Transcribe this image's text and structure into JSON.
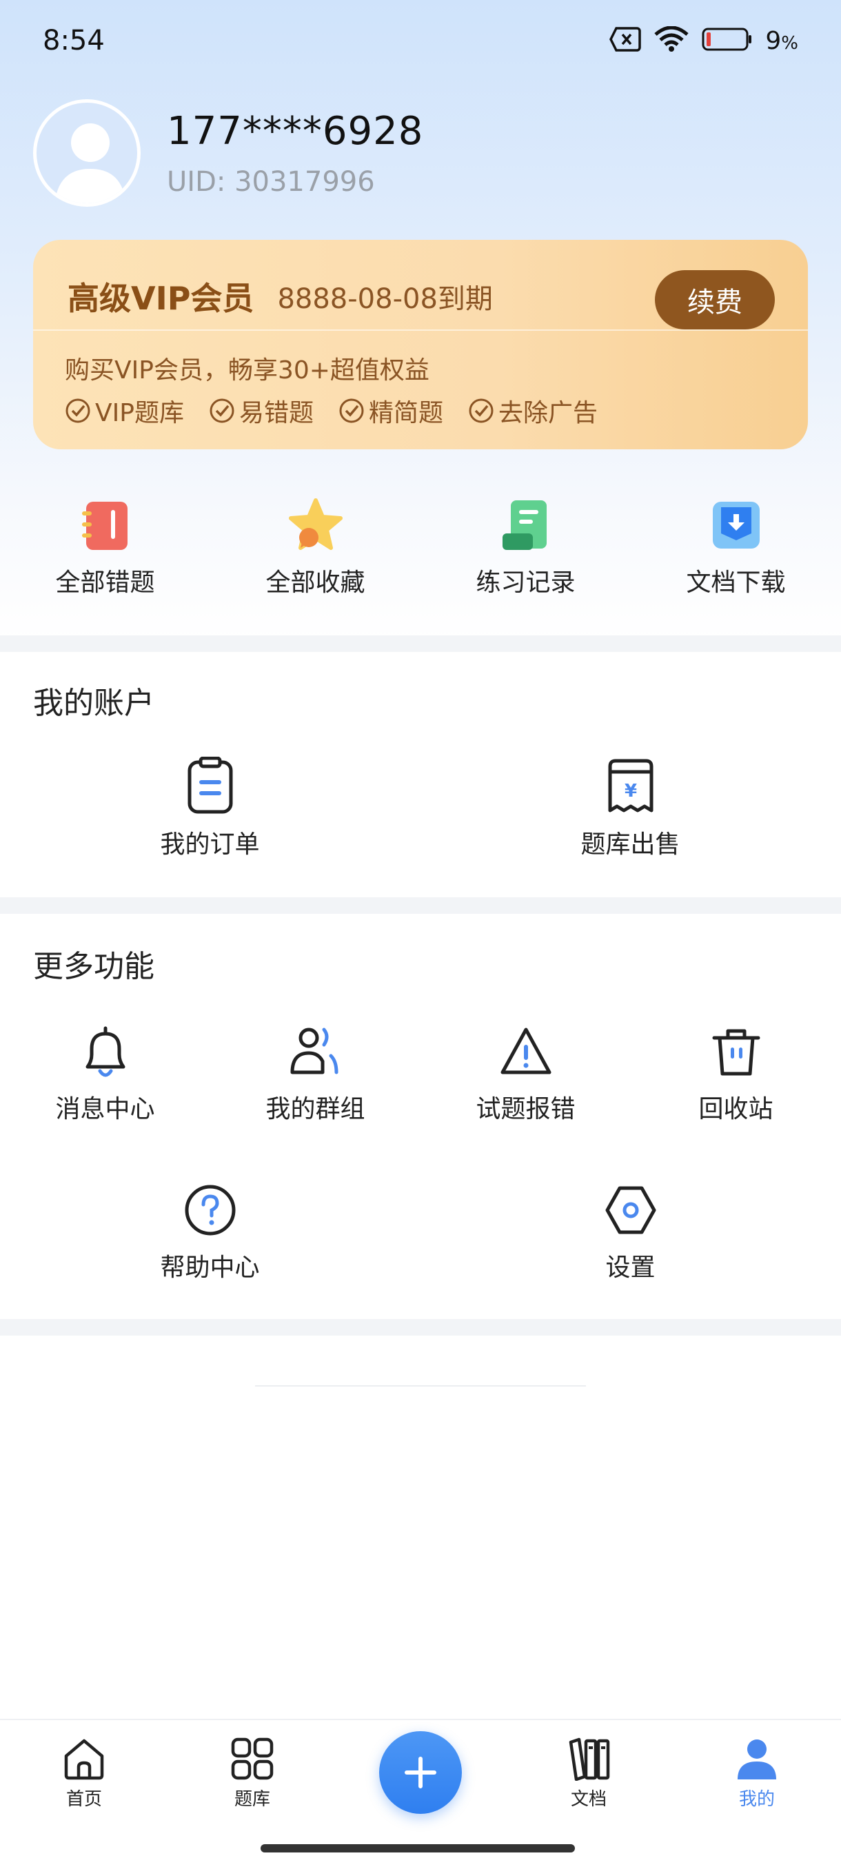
{
  "status_bar": {
    "time": "8:54",
    "battery": "9",
    "battery_unit": "%"
  },
  "profile": {
    "phone": "177****6928",
    "uid": "UID: 30317996"
  },
  "vip": {
    "title": "高级VIP会员",
    "expire": "8888-08-08到期",
    "renew_label": "续费",
    "description": "购买VIP会员，畅享30+超值权益",
    "tags": [
      "VIP题库",
      "易错题",
      "精简题",
      "去除广告"
    ]
  },
  "quick_actions": [
    {
      "label": "全部错题",
      "icon": "notebook-icon"
    },
    {
      "label": "全部收藏",
      "icon": "star-icon"
    },
    {
      "label": "练习记录",
      "icon": "record-icon"
    },
    {
      "label": "文档下载",
      "icon": "download-icon"
    }
  ],
  "account": {
    "title": "我的账户",
    "items": [
      {
        "label": "我的订单",
        "icon": "order-icon"
      },
      {
        "label": "题库出售",
        "icon": "sale-icon"
      }
    ]
  },
  "more": {
    "title": "更多功能",
    "items": [
      {
        "label": "消息中心",
        "icon": "bell-icon"
      },
      {
        "label": "我的群组",
        "icon": "group-icon"
      },
      {
        "label": "试题报错",
        "icon": "warning-icon"
      },
      {
        "label": "回收站",
        "icon": "trash-icon"
      },
      {
        "label": "帮助中心",
        "icon": "help-icon"
      },
      {
        "label": "设置",
        "icon": "settings-icon"
      }
    ]
  },
  "bottom_nav": {
    "items": [
      {
        "label": "首页",
        "icon": "home-icon"
      },
      {
        "label": "题库",
        "icon": "grid-icon"
      },
      {
        "label": "文档",
        "icon": "books-icon"
      },
      {
        "label": "我的",
        "icon": "user-icon"
      }
    ],
    "active": "我的"
  },
  "colors": {
    "accent": "#4a88ee",
    "vip_brown": "#8f561f"
  }
}
